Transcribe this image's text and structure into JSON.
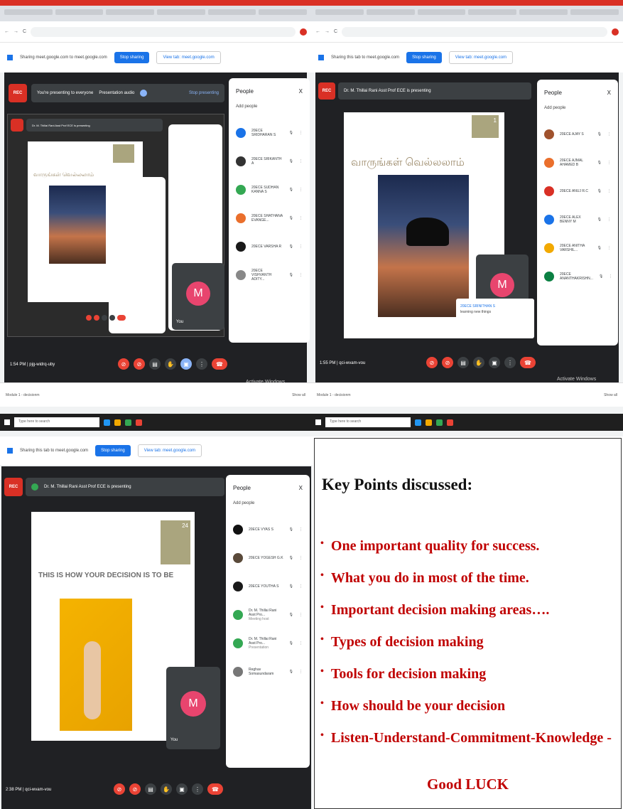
{
  "q1": {
    "share_text": "Sharing meet.google.com to meet.google.com",
    "stop_sharing": "Stop sharing",
    "view_tab": "View tab: meet.google.com",
    "presenting": "You're presenting to everyone",
    "presentation_audio": "Presentation audio",
    "stop_presenting": "Stop presenting",
    "people_title": "People",
    "add_people": "Add people",
    "time": "1:54 PM",
    "code": "pjg-widrq-uby",
    "activate": "Activate Windows",
    "tile_name": "You",
    "tile_initial": "M",
    "inner_presenter": "Dr. M. Thillai Rani Asst Prof ECE is presenting",
    "participants": [
      {
        "name": "20ECE SRIDHARAN S",
        "color": "#1a73e8"
      },
      {
        "name": "20ECE SRIKANTH A",
        "color": "#333333"
      },
      {
        "name": "20ECE SUDHAN KANNA S",
        "color": "#34a853"
      },
      {
        "name": "20ECE SHATHANA EVANGE...",
        "color": "#ea6f2c"
      },
      {
        "name": "20ECE VARSHA R",
        "color": "#1a1a1a"
      },
      {
        "name": "20ECE VISHVANTH ADITY...",
        "color": "#888888"
      }
    ],
    "download": "Module 1 - decisionm",
    "show_all": "Show all",
    "search": "Type here to search"
  },
  "q2": {
    "share_text": "Sharing this tab to meet.google.com",
    "stop_sharing": "Stop sharing",
    "view_tab": "View tab: meet.google.com",
    "presenting": "Dr. M. Thillai Rani Asst Prof ECE is presenting",
    "people_title": "People",
    "add_people": "Add people",
    "time": "1:55 PM",
    "code": "qci-wvam-vou",
    "activate": "Activate Windows",
    "tile_initial": "M",
    "slide_num": "1",
    "tamil": "வாருங்கள் வெல்லலாம்",
    "popup_name": "20ECE SRINITHAN S",
    "popup_text": "learning new things",
    "participants": [
      {
        "name": "20ECE AJAY S",
        "color": "#a0522d"
      },
      {
        "name": "20ECE AJMAL AHAMED B",
        "color": "#ea6f2c"
      },
      {
        "name": "20ECE ANUJ R.C",
        "color": "#d93025"
      },
      {
        "name": "20ECE ALEX BENNY M",
        "color": "#1a73e8"
      },
      {
        "name": "20ECE ANITHA VARSHIL...",
        "color": "#f2a900"
      },
      {
        "name": "20ECE ANANTHAKRISHN...",
        "color": "#0b8043"
      }
    ],
    "download": "Module 1 - decisionm",
    "show_all": "Show all",
    "search": "Type here to search"
  },
  "q3": {
    "share_text": "Sharing this tab to meet.google.com",
    "stop_sharing": "Stop sharing",
    "view_tab": "View tab: meet.google.com",
    "presenting": "Dr. M. Thillai Rani Asst Prof ECE is presenting",
    "people_title": "People",
    "add_people": "Add people",
    "time": "2:38 PM",
    "code": "qci-wvam-vou",
    "tile_name": "You",
    "tile_initial": "M",
    "slide_num": "24",
    "slide_title": "THIS IS HOW YOUR DECISION IS TO BE",
    "participants": [
      {
        "name": "20ECE VYAS S",
        "sub": "",
        "color": "#111111"
      },
      {
        "name": "20ECE YOGESH G.K",
        "sub": "",
        "color": "#5a4a3a"
      },
      {
        "name": "20ECE YOUTHA S",
        "sub": "",
        "color": "#1a1a1a"
      },
      {
        "name": "Dr. M. Thillai Rani Asst Pro...",
        "sub": "Meeting host",
        "color": "#34a853"
      },
      {
        "name": "Dr. M. Thillai Rani Asst Pro...",
        "sub": "Presentation",
        "color": "#34a853"
      },
      {
        "name": "Reghav Somasundaram",
        "sub": "",
        "color": "#777777"
      }
    ]
  },
  "q4": {
    "title": "Key Points discussed:",
    "bullet": "•",
    "points": [
      "One important quality for success.",
      "What you do in most of the time.",
      "Important  decision making areas….",
      "Types of decision making",
      "Tools for decision making",
      "How should be your decision",
      "Listen-Understand-Commitment-Knowledge -"
    ],
    "closing": "Good LUCK"
  },
  "common": {
    "rec": "REC",
    "close": "X",
    "more": "⋮",
    "mic": "🎙"
  }
}
